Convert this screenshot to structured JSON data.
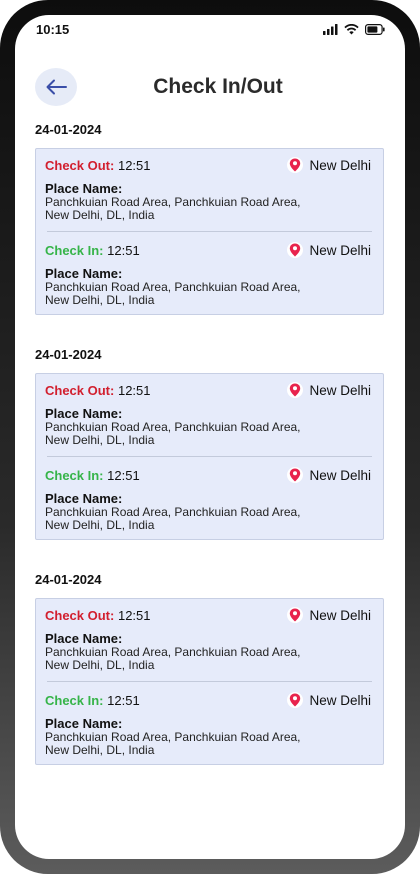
{
  "status_bar": {
    "time": "10:15"
  },
  "header": {
    "title": "Check In/Out",
    "back_icon": "arrow-left-icon"
  },
  "colors": {
    "check_out": "#d21f2e",
    "check_in": "#36b449",
    "card_bg": "#e6ebfa",
    "back_button_bg": "#e6ebf7",
    "pin": "#e8234d"
  },
  "sections": [
    {
      "date": "24-01-2024",
      "entries": [
        {
          "type_label": "Check Out:",
          "time": "12:51",
          "location": "New Delhi",
          "place_label": "Place Name:",
          "address_line1": "Panchkuian Road Area, Panchkuian Road Area,",
          "address_line2": "New Delhi, DL, India"
        },
        {
          "type_label": "Check In:",
          "time": "12:51",
          "location": "New Delhi",
          "place_label": "Place Name:",
          "address_line1": "Panchkuian Road Area, Panchkuian Road Area,",
          "address_line2": "New Delhi, DL, India"
        }
      ]
    },
    {
      "date": "24-01-2024",
      "entries": [
        {
          "type_label": "Check Out:",
          "time": "12:51",
          "location": "New Delhi",
          "place_label": "Place Name:",
          "address_line1": "Panchkuian Road Area, Panchkuian Road Area,",
          "address_line2": "New Delhi, DL, India"
        },
        {
          "type_label": "Check In:",
          "time": "12:51",
          "location": "New Delhi",
          "place_label": "Place Name:",
          "address_line1": "Panchkuian Road Area, Panchkuian Road Area,",
          "address_line2": "New Delhi, DL, India"
        }
      ]
    },
    {
      "date": "24-01-2024",
      "entries": [
        {
          "type_label": "Check Out:",
          "time": "12:51",
          "location": "New Delhi",
          "place_label": "Place Name:",
          "address_line1": "Panchkuian Road Area, Panchkuian Road Area,",
          "address_line2": "New Delhi, DL, India"
        },
        {
          "type_label": "Check In:",
          "time": "12:51",
          "location": "New Delhi",
          "place_label": "Place Name:",
          "address_line1": "Panchkuian Road Area, Panchkuian Road Area,",
          "address_line2": "New Delhi, DL, India"
        }
      ]
    }
  ]
}
